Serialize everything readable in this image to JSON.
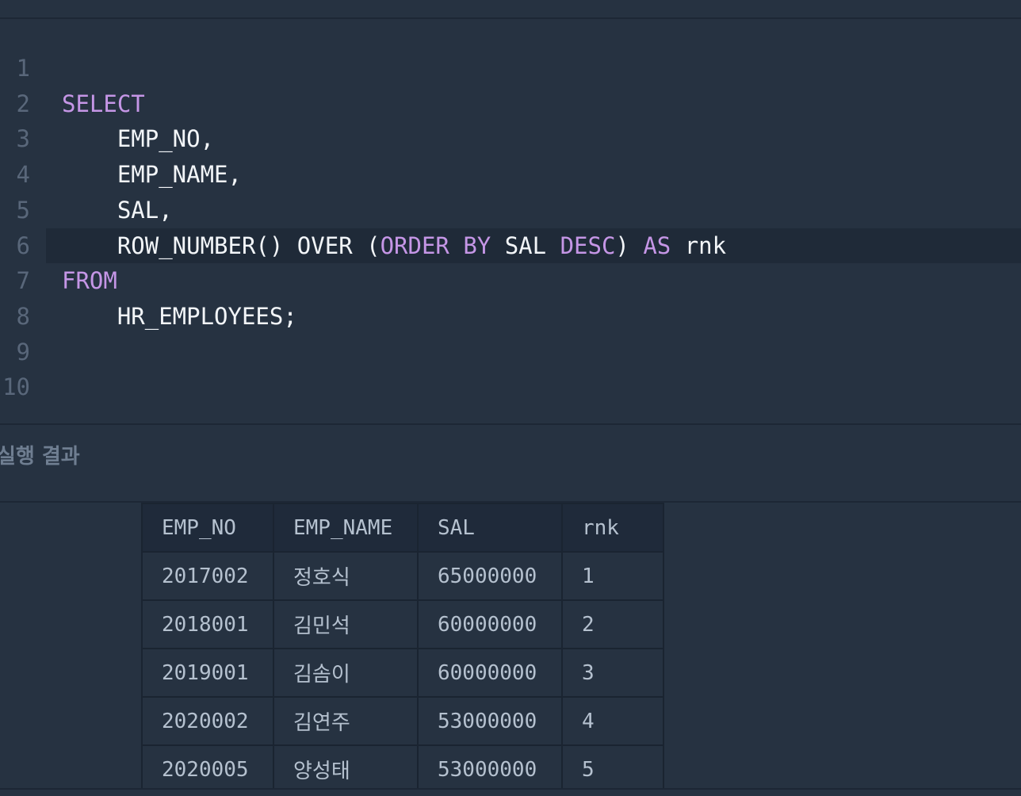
{
  "editor": {
    "lines": [
      {
        "num": "1",
        "tokens": []
      },
      {
        "num": "2",
        "tokens": [
          {
            "t": "SELECT",
            "kw": true
          }
        ]
      },
      {
        "num": "3",
        "tokens": [
          {
            "t": "    EMP_NO,",
            "kw": false
          }
        ]
      },
      {
        "num": "4",
        "tokens": [
          {
            "t": "    EMP_NAME,",
            "kw": false
          }
        ]
      },
      {
        "num": "5",
        "tokens": [
          {
            "t": "    SAL,",
            "kw": false
          }
        ]
      },
      {
        "num": "6",
        "active": true,
        "tokens": [
          {
            "t": "    ROW_NUMBER() OVER (",
            "kw": false
          },
          {
            "t": "ORDER BY",
            "kw": true
          },
          {
            "t": " SAL ",
            "kw": false
          },
          {
            "t": "DESC",
            "kw": true
          },
          {
            "t": ") ",
            "kw": false
          },
          {
            "t": "AS",
            "kw": true
          },
          {
            "t": " rnk",
            "kw": false
          }
        ]
      },
      {
        "num": "7",
        "tokens": [
          {
            "t": "FROM",
            "kw": true
          }
        ]
      },
      {
        "num": "8",
        "tokens": [
          {
            "t": "    HR_EMPLOYEES;",
            "kw": false
          }
        ]
      },
      {
        "num": "9",
        "tokens": []
      },
      {
        "num": "10",
        "tokens": []
      }
    ],
    "colors": {
      "keyword": "#c596e6",
      "text": "#f2f5f8",
      "line_number": "#59677a",
      "background": "#263241"
    }
  },
  "results": {
    "title": "실행 결과",
    "columns": [
      "EMP_NO",
      "EMP_NAME",
      "SAL",
      "rnk"
    ],
    "rows": [
      [
        "2017002",
        "정호식",
        "65000000",
        "1"
      ],
      [
        "2018001",
        "김민석",
        "60000000",
        "2"
      ],
      [
        "2019001",
        "김솜이",
        "60000000",
        "3"
      ],
      [
        "2020002",
        "김연주",
        "53000000",
        "4"
      ],
      [
        "2020005",
        "양성태",
        "53000000",
        "5"
      ]
    ]
  }
}
